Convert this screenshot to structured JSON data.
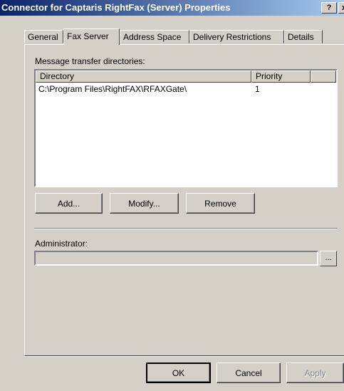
{
  "window": {
    "title": "Connector for Captaris RightFax (Server) Properties",
    "help_label": "?",
    "close_label": "x"
  },
  "tabs": [
    {
      "label": "General",
      "active": false
    },
    {
      "label": "Fax Server",
      "active": true
    },
    {
      "label": "Address Space",
      "active": false
    },
    {
      "label": "Delivery Restrictions",
      "active": false
    },
    {
      "label": "Details",
      "active": false
    }
  ],
  "fax_server": {
    "mtd_label": "Message transfer directories:",
    "columns": [
      "Directory",
      "Priority"
    ],
    "rows": [
      {
        "directory": "C:\\Program Files\\RightFAX\\RFAXGate\\",
        "priority": "1"
      }
    ],
    "buttons": {
      "add": "Add...",
      "modify": "Modify...",
      "remove": "Remove"
    },
    "admin_label": "Administrator:",
    "admin_value": "",
    "browse_label": "..."
  },
  "footer": {
    "ok": "OK",
    "cancel": "Cancel",
    "apply": "Apply"
  }
}
